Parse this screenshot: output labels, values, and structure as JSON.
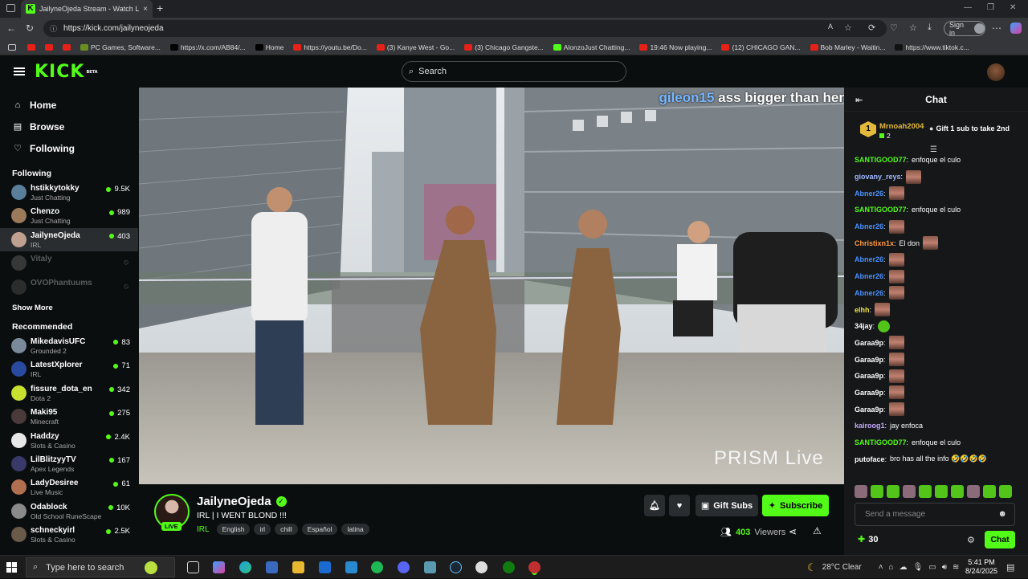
{
  "browser": {
    "tab_title": "JailyneOjeda Stream - Watch Live",
    "tab_close": "×",
    "new_tab": "+",
    "url": "https://kick.com/jailyneojeda",
    "signin_label": "Sign in",
    "bookmarks": [
      {
        "label": "",
        "icon": "youtube-icon"
      },
      {
        "label": "",
        "icon": "youtube-icon"
      },
      {
        "label": "",
        "icon": "youtube-icon"
      },
      {
        "label": "PC Games, Software...",
        "icon": "pc-icon"
      },
      {
        "label": "https://x.com/AB84/...",
        "icon": "x-icon"
      },
      {
        "label": "Home",
        "icon": "x-icon"
      },
      {
        "label": "https://youtu.be/Do...",
        "icon": "youtube-icon"
      },
      {
        "label": "(3) Kanye West - Go...",
        "icon": "youtube-icon"
      },
      {
        "label": "(3) Chicago Gangste...",
        "icon": "youtube-icon"
      },
      {
        "label": "AlonzoJust Chatting...",
        "icon": "kick-icon"
      },
      {
        "label": "19:46 Now playing...",
        "icon": "youtube-icon"
      },
      {
        "label": "(12) CHICAGO GAN...",
        "icon": "youtube-icon"
      },
      {
        "label": "Bob Marley - Waitin...",
        "icon": "youtube-icon"
      },
      {
        "label": "https://www.tiktok.c...",
        "icon": "tiktok-icon"
      }
    ]
  },
  "header": {
    "logo": "KICK",
    "logo_badge": "BETA",
    "search_placeholder": "Search"
  },
  "sidebar": {
    "nav": [
      {
        "label": "Home",
        "icon": "home-icon"
      },
      {
        "label": "Browse",
        "icon": "browse-icon"
      },
      {
        "label": "Following",
        "icon": "heart-icon"
      }
    ],
    "following_heading": "Following",
    "following": [
      {
        "name": "hstikkytokky",
        "category": "Just Chatting",
        "viewers": "9.5K",
        "color": "#5a7f9a",
        "live": true
      },
      {
        "name": "Chenzo",
        "category": "Just Chatting",
        "viewers": "989",
        "color": "#9a7a5a",
        "live": true
      },
      {
        "name": "JailyneOjeda",
        "category": "IRL",
        "viewers": "403",
        "color": "#c0a090",
        "live": true
      },
      {
        "name": "Vitaly",
        "category": "",
        "viewers": "",
        "color": "#888888",
        "live": false
      },
      {
        "name": "OVOPhantuums",
        "category": "",
        "viewers": "",
        "color": "#666666",
        "live": false
      }
    ],
    "show_more": "Show More",
    "recommended_heading": "Recommended",
    "recommended": [
      {
        "name": "MikedavisUFC",
        "category": "Grounded 2",
        "viewers": "83",
        "color": "#7a8a9a"
      },
      {
        "name": "LatestXplorer",
        "category": "IRL",
        "viewers": "71",
        "color": "#2a4aa0"
      },
      {
        "name": "fissure_dota_en",
        "category": "Dota 2",
        "viewers": "342",
        "color": "#c8e030"
      },
      {
        "name": "Maki95",
        "category": "Minecraft",
        "viewers": "275",
        "color": "#4a3a3a"
      },
      {
        "name": "Haddzy",
        "category": "Slots & Casino",
        "viewers": "2.4K",
        "color": "#e8e8e8"
      },
      {
        "name": "LilBlitzyyTV",
        "category": "Apex Legends",
        "viewers": "167",
        "color": "#3a3a6a"
      },
      {
        "name": "LadyDesiree",
        "category": "Live Music",
        "viewers": "61",
        "color": "#b07050"
      },
      {
        "name": "Odablock",
        "category": "Old School RuneScape",
        "viewers": "10K",
        "color": "#8a8a8a"
      },
      {
        "name": "schneckyirl",
        "category": "Slots & Casino",
        "viewers": "2.5K",
        "color": "#6a5a4a"
      }
    ]
  },
  "video": {
    "overlay_user": "gileon15",
    "overlay_text": "ass bigger than her",
    "watermark": "PRISM Live"
  },
  "stream": {
    "name": "JailyneOjeda",
    "live_badge": "LIVE",
    "title": "IRL | I WENT BLOND !!!",
    "category": "IRL",
    "tags": [
      "English",
      "irl",
      "chill",
      "Español",
      "latina"
    ],
    "gift_label": "Gift Subs",
    "subscribe_label": "Subscribe",
    "viewers_count": "403",
    "viewers_label": "Viewers"
  },
  "chat": {
    "title": "Chat",
    "pinned": {
      "rank": "1",
      "name": "Mrnoah2004",
      "count": "2",
      "text": "Gift 1 sub to take 2nd"
    },
    "messages": [
      {
        "user": "SANTIGOOD77",
        "color": "#53fc18",
        "text": "enfoque el culo",
        "emote": false
      },
      {
        "user": "giovany_reys",
        "color": "#a0b8ff",
        "text": "",
        "emote": true
      },
      {
        "user": "Abner26",
        "color": "#4a90ff",
        "text": "",
        "emote": true
      },
      {
        "user": "SANTIGOOD77",
        "color": "#53fc18",
        "text": "enfoque el culo",
        "emote": false
      },
      {
        "user": "Abner26",
        "color": "#4a90ff",
        "text": "",
        "emote": true
      },
      {
        "user": "Christixn1x",
        "color": "#ff9a3a",
        "text": "El don",
        "emote": true
      },
      {
        "user": "Abner26",
        "color": "#4a90ff",
        "text": "",
        "emote": true
      },
      {
        "user": "Abner26",
        "color": "#4a90ff",
        "text": "",
        "emote": true
      },
      {
        "user": "Abner26",
        "color": "#4a90ff",
        "text": "",
        "emote": true
      },
      {
        "user": "elhh",
        "color": "#f0e040",
        "text": "",
        "emote": true
      },
      {
        "user": "34jay",
        "color": "#ffffff",
        "text": "",
        "emote": "green"
      },
      {
        "user": "Garaa9p",
        "color": "#ffffff",
        "text": "",
        "emote": true
      },
      {
        "user": "Garaa9p",
        "color": "#ffffff",
        "text": "",
        "emote": true
      },
      {
        "user": "Garaa9p",
        "color": "#ffffff",
        "text": "",
        "emote": true
      },
      {
        "user": "Garaa9p",
        "color": "#ffffff",
        "text": "",
        "emote": true
      },
      {
        "user": "Garaa9p",
        "color": "#ffffff",
        "text": "",
        "emote": true
      },
      {
        "user": "kairoog1",
        "color": "#c8a8ff",
        "text": "jay enfoca",
        "emote": false
      },
      {
        "user": "SANTIGOOD77",
        "color": "#53fc18",
        "text": "enfoque el culo",
        "emote": false
      },
      {
        "user": "putoface",
        "color": "#ffffff",
        "text": "bro has all the info 🤣🤣🤣🤣",
        "emote": false
      }
    ],
    "input_placeholder": "Send a message",
    "points": "30",
    "chat_button": "Chat"
  },
  "taskbar": {
    "search_placeholder": "Type here to search",
    "weather": "28°C  Clear",
    "time": "5:41 PM",
    "date": "8/24/2025"
  },
  "colors": {
    "accent": "#53fc18",
    "bg": "#0b0e0f",
    "chat_bg": "#151719"
  }
}
